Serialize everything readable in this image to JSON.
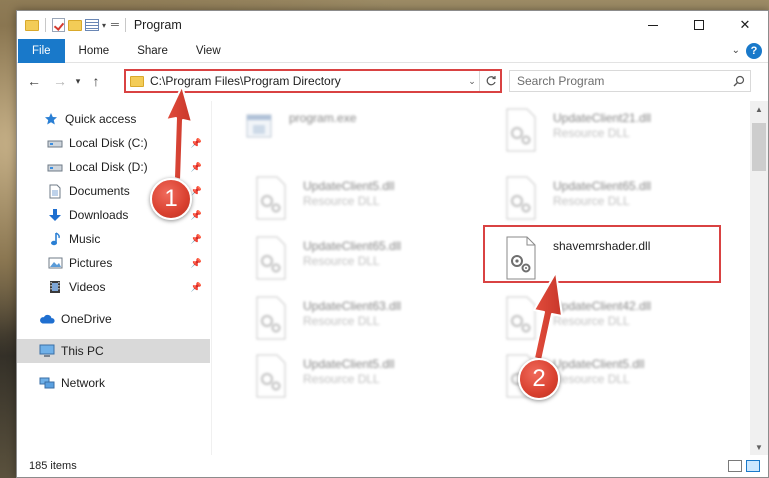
{
  "window": {
    "title": "Program",
    "controls": {
      "minimize": "",
      "maximize": "",
      "close": "✕"
    }
  },
  "ribbon": {
    "tabs": [
      {
        "label": "File",
        "active": true
      },
      {
        "label": "Home"
      },
      {
        "label": "Share"
      },
      {
        "label": "View"
      }
    ]
  },
  "address": {
    "path": "C:\\Program Files\\Program Directory"
  },
  "search": {
    "placeholder": "Search Program"
  },
  "sidebar": {
    "items": [
      {
        "label": "Quick access",
        "icon": "star-icon"
      },
      {
        "label": "Local Disk (C:)",
        "icon": "drive-icon",
        "pinned": true
      },
      {
        "label": "Local Disk (D:)",
        "icon": "drive-icon",
        "pinned": true
      },
      {
        "label": "Documents",
        "icon": "documents-icon",
        "pinned": true
      },
      {
        "label": "Downloads",
        "icon": "downloads-icon",
        "pinned": true
      },
      {
        "label": "Music",
        "icon": "music-icon",
        "pinned": true
      },
      {
        "label": "Pictures",
        "icon": "pictures-icon",
        "pinned": true
      },
      {
        "label": "Videos",
        "icon": "videos-icon",
        "pinned": true
      },
      {
        "label": "OneDrive",
        "icon": "cloud-icon"
      },
      {
        "label": "This PC",
        "icon": "computer-icon",
        "selected": true
      },
      {
        "label": "Network",
        "icon": "network-icon"
      }
    ]
  },
  "files": [
    {
      "name": "program.exe",
      "type": "",
      "blurred": true,
      "kind": "exe"
    },
    {
      "name": "UpdateClient21.dll",
      "type": "Resource DLL",
      "blurred": true,
      "kind": "dll"
    },
    {
      "name": "UpdateClient5.dll",
      "type": "Resource DLL",
      "blurred": true,
      "kind": "dll"
    },
    {
      "name": "UpdateClient65.dll",
      "type": "Resource DLL",
      "blurred": true,
      "kind": "dll"
    },
    {
      "name": "UpdateClient65.dll",
      "type": "Resource DLL",
      "blurred": true,
      "kind": "dll"
    },
    {
      "name": "shavemrshader.dll",
      "type": "",
      "blurred": false,
      "kind": "dll"
    },
    {
      "name": "UpdateClient63.dll",
      "type": "Resource DLL",
      "blurred": true,
      "kind": "dll"
    },
    {
      "name": "UpdateClient42.dll",
      "type": "Resource DLL",
      "blurred": true,
      "kind": "dll"
    },
    {
      "name": "UpdateClient5.dll",
      "type": "Resource DLL",
      "blurred": true,
      "kind": "dll"
    },
    {
      "name": "UpdateClient5.dll",
      "type": "Resource DLL",
      "blurred": true,
      "kind": "dll"
    }
  ],
  "status": {
    "count": "185 items"
  },
  "callouts": [
    {
      "number": "1"
    },
    {
      "number": "2"
    }
  ],
  "colors": {
    "accent": "#1979ca",
    "highlight": "#d94242",
    "badge": "#d9402f"
  }
}
